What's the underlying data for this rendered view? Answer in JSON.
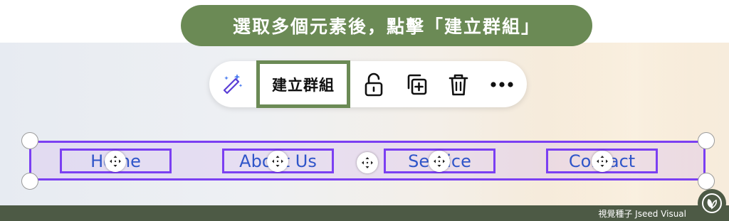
{
  "caption": {
    "text": "選取多個元素後，點擊「建立群組」"
  },
  "toolbar": {
    "magic_icon": "magic-pencil-icon",
    "group_label": "建立群組",
    "lock_icon": "unlock-icon",
    "duplicate_icon": "duplicate-icon",
    "delete_icon": "trash-icon",
    "more_icon": "more-icon"
  },
  "nav": {
    "items": [
      {
        "label": "Home"
      },
      {
        "label": "About Us"
      },
      {
        "label": "Service"
      },
      {
        "label": "Contact"
      }
    ]
  },
  "colors": {
    "accent_green": "#6b8a55",
    "selection_purple": "#7b3ff2",
    "nav_text_blue": "#2f55c9",
    "footer_bg": "#4d5a45"
  },
  "footer": {
    "brand": "視覺種子 Jseed Visual"
  }
}
